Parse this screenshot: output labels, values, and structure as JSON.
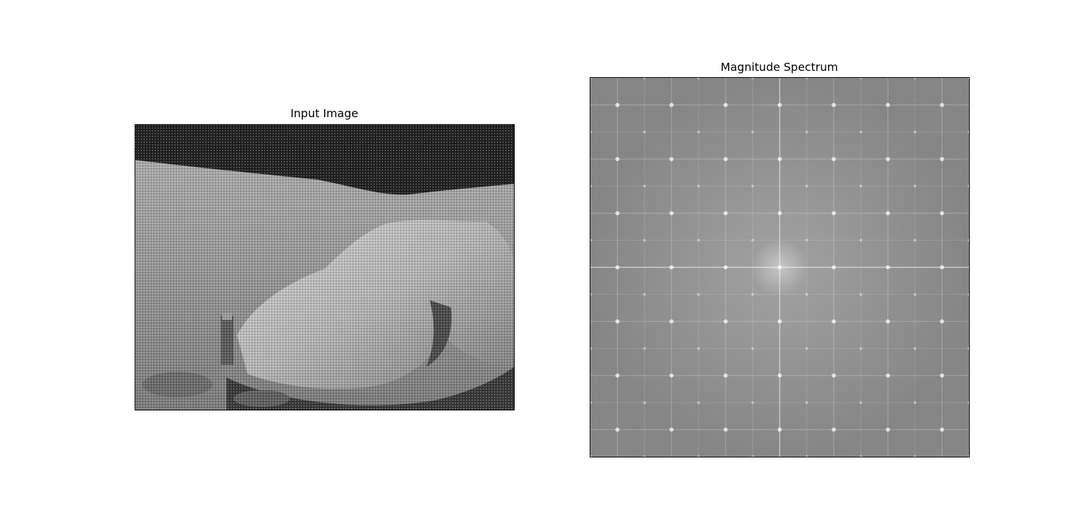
{
  "figure": {
    "panels": [
      {
        "title": "Input Image"
      },
      {
        "title": "Magnitude Spectrum"
      }
    ],
    "colors": {
      "background": "#ffffff",
      "axis_frame": "#000000",
      "spectrum_base": "#808080",
      "sky": "#202020",
      "ground": "#9a9a9a",
      "rock": "#b8b8b8"
    }
  }
}
